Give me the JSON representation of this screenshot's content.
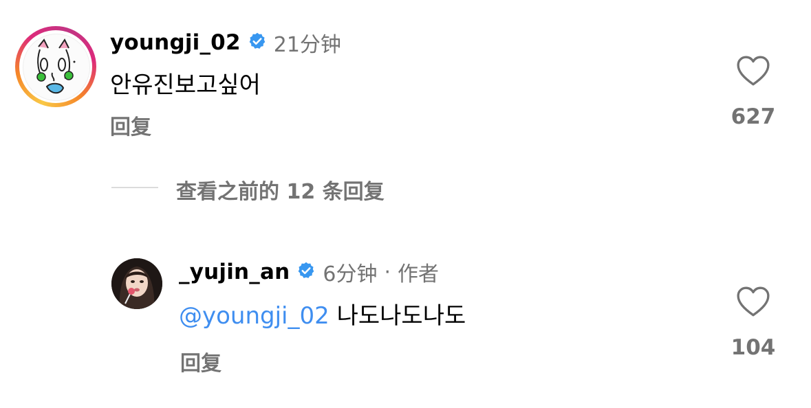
{
  "comment": {
    "username": "youngji_02",
    "time": "21分钟",
    "text": "안유진보고싶어",
    "reply_label": "回复",
    "like_count": "627"
  },
  "view_previous": {
    "label": "查看之前的 12 条回复"
  },
  "reply": {
    "username": "_yujin_an",
    "time": "6分钟",
    "separator": "·",
    "author_tag": "作者",
    "mention": "@youngji_02",
    "text": "나도나도나도",
    "reply_label": "回复",
    "like_count": "104"
  },
  "colors": {
    "verified_badge": "#3897f0",
    "mention": "#3f8ef0",
    "secondary_text": "#737373"
  }
}
